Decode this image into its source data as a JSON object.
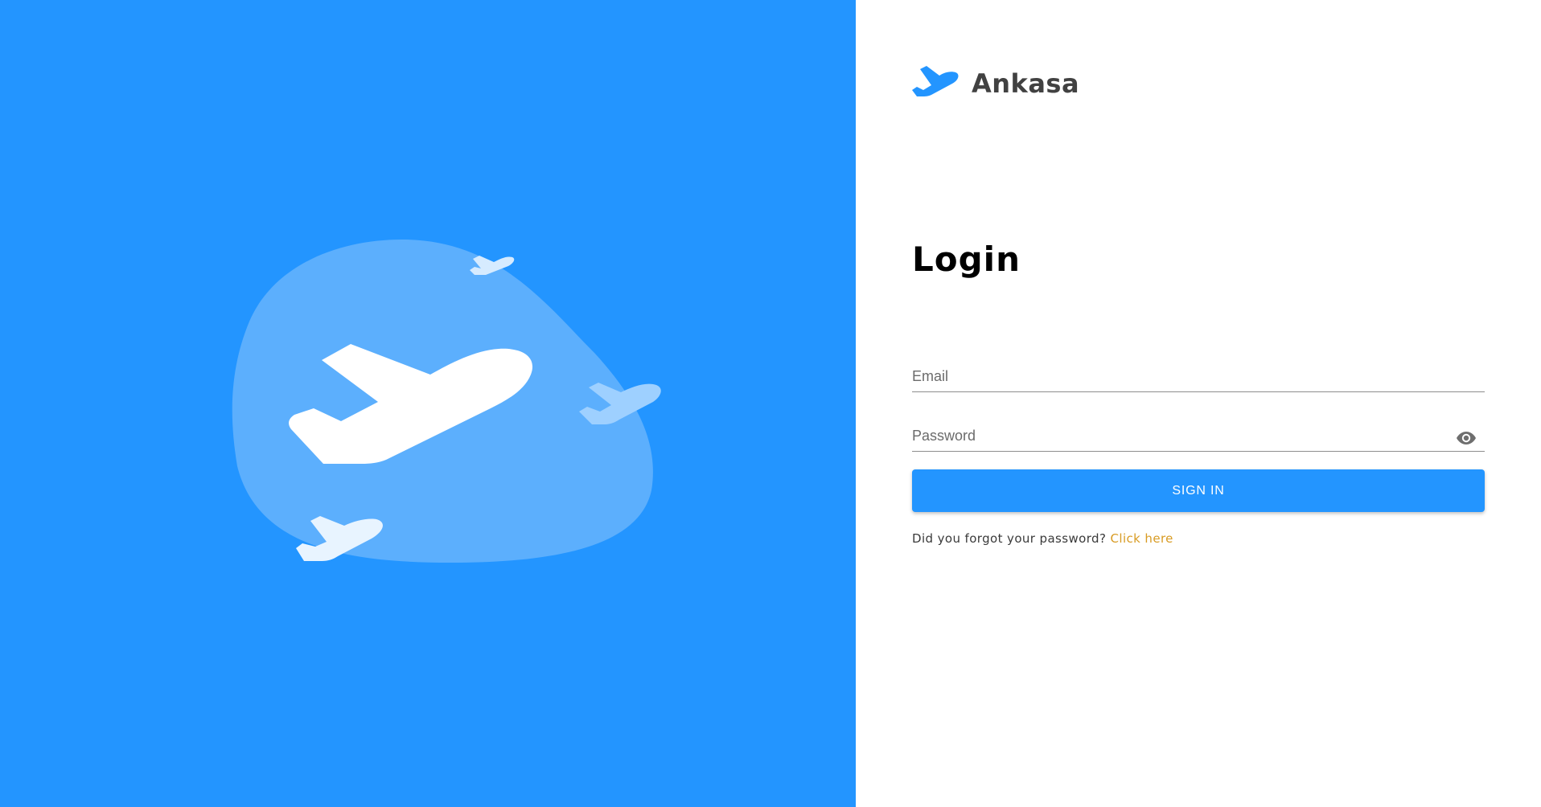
{
  "brand": {
    "name": "Ankasa",
    "logo_icon": "plane-takeoff-icon"
  },
  "hero": {
    "background_color": "#2395ff",
    "illustration_icon": "airplane-illustration"
  },
  "login": {
    "title": "Login",
    "email_placeholder": "Email",
    "email_value": "",
    "password_placeholder": "Password",
    "password_value": "",
    "password_toggle_icon": "eye-icon",
    "submit_label": "SIGN IN",
    "forgot_text": "Did you forgot your password?",
    "forgot_link": "Click here"
  },
  "colors": {
    "accent": "#2395ff",
    "link": "#d89b23",
    "brand_text": "#414141"
  }
}
